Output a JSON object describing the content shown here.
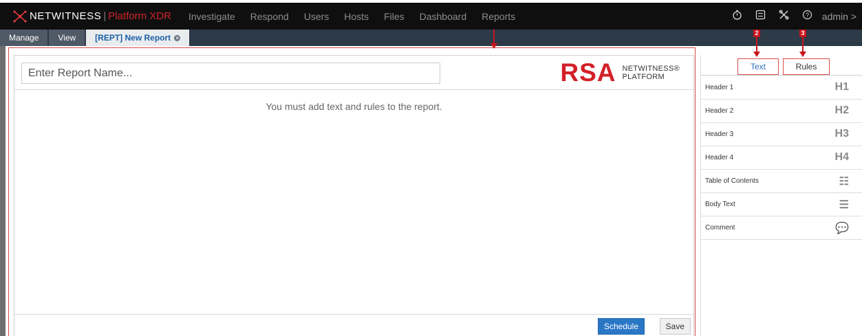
{
  "topnav": {
    "brand": "NETWITNESS",
    "product": "Platform XDR",
    "links": [
      "Investigate",
      "Respond",
      "Users",
      "Hosts",
      "Files",
      "Dashboard",
      "Reports"
    ],
    "icons": [
      "timer-icon",
      "settings-panel-icon",
      "tools-icon",
      "help-icon"
    ],
    "user": "admin",
    "user_chevron": ">"
  },
  "tabs": {
    "manage": "Manage",
    "view": "View",
    "active": "[REPT] New Report"
  },
  "editor": {
    "name_placeholder": "Enter Report Name...",
    "logo_word": "RSA",
    "logo_sub_line1": "NETWITNESS®",
    "logo_sub_line2": "PLATFORM",
    "empty_message": "You must add text and rules to the report.",
    "schedule_label": "Schedule",
    "save_label": "Save"
  },
  "right_panel": {
    "tab_text": "Text",
    "tab_rules": "Rules",
    "items": [
      {
        "label": "Header 1",
        "icon": "H1"
      },
      {
        "label": "Header 2",
        "icon": "H2"
      },
      {
        "label": "Header 3",
        "icon": "H3"
      },
      {
        "label": "Header 4",
        "icon": "H4"
      },
      {
        "label": "Table of Contents",
        "icon": "☷"
      },
      {
        "label": "Body Text",
        "icon": "☰"
      },
      {
        "label": "Comment",
        "icon": "💬"
      }
    ]
  },
  "callouts": {
    "c2": "2",
    "c3": "3"
  },
  "colors": {
    "brand_red": "#d32027",
    "accent_blue": "#2a77c6",
    "nav_bg": "#0f0f10",
    "tabbar_bg": "#2d3a48",
    "callout_red": "#c8141c"
  }
}
